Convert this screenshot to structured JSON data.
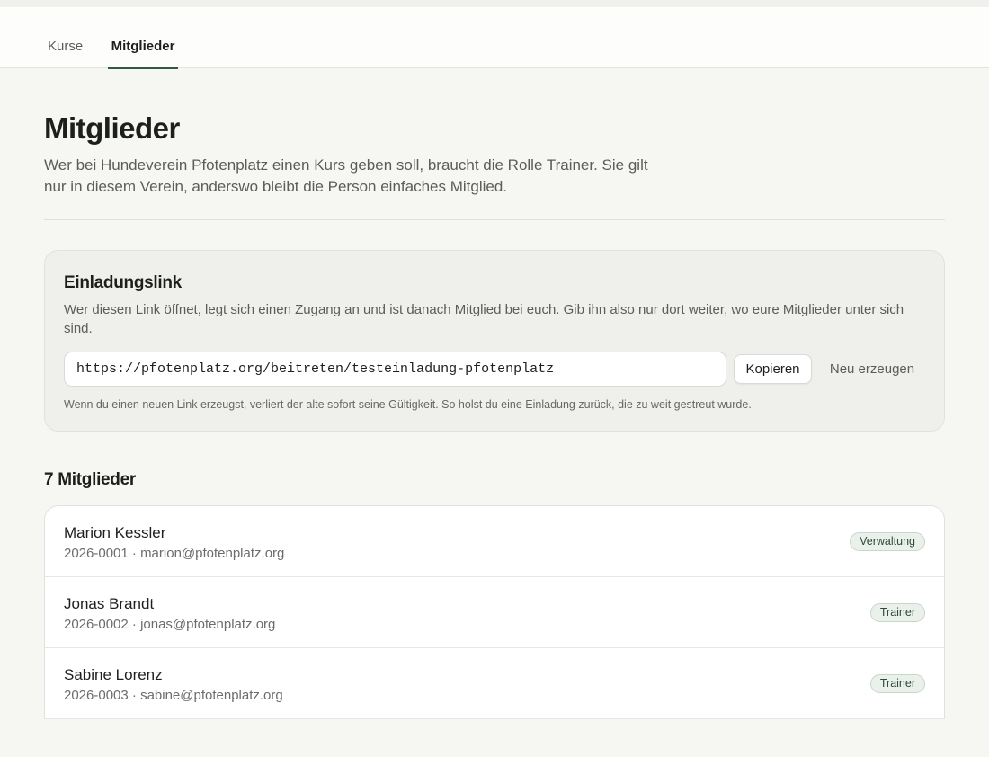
{
  "nav": {
    "tabs": [
      {
        "label": "Kurse"
      },
      {
        "label": "Mitglieder"
      }
    ]
  },
  "header": {
    "title": "Mitglieder",
    "description": "Wer bei Hundeverein Pfotenplatz einen Kurs geben soll, braucht die Rolle Trainer. Sie gilt nur in diesem Verein, anderswo bleibt die Person einfaches Mitglied."
  },
  "invite": {
    "title": "Einladungslink",
    "description": "Wer diesen Link öffnet, legt sich einen Zugang an und ist danach Mitglied bei euch. Gib ihn also nur dort weiter, wo eure Mitglieder unter sich sind.",
    "link": "https://pfotenplatz.org/beitreten/testeinladung-pfotenplatz",
    "copy_label": "Kopieren",
    "regenerate_label": "Neu erzeugen",
    "note": "Wenn du einen neuen Link erzeugst, verliert der alte sofort seine Gültigkeit. So holst du eine Einladung zurück, die zu weit gestreut wurde."
  },
  "members": {
    "heading": "7 Mitglieder",
    "items": [
      {
        "name": "Marion Kessler",
        "meta": "2026-0001 · marion@pfotenplatz.org",
        "role": "Verwaltung"
      },
      {
        "name": "Jonas Brandt",
        "meta": "2026-0002 · jonas@pfotenplatz.org",
        "role": "Trainer"
      },
      {
        "name": "Sabine Lorenz",
        "meta": "2026-0003 · sabine@pfotenplatz.org",
        "role": "Trainer"
      }
    ]
  },
  "colors": {
    "accent": "#2f5a45",
    "background": "#f6f6f3",
    "badge_bg": "#eaf0ea"
  }
}
